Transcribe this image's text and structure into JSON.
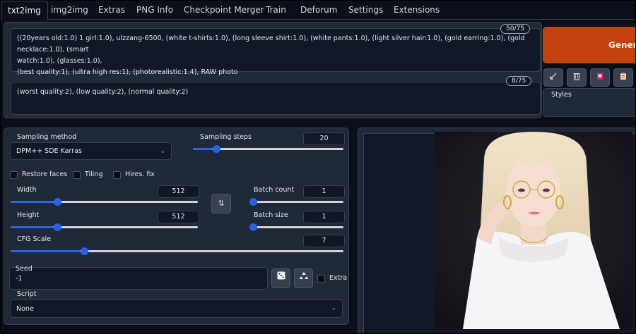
{
  "tabs": [
    "txt2img",
    "img2img",
    "Extras",
    "PNG Info",
    "Checkpoint Merger",
    "Train",
    "Deforum",
    "Settings",
    "Extensions"
  ],
  "prompt": {
    "line1": "((20years old:1.0) 1 girl:1.0), ulzzang-6500, (white t-shirts:1.0), (long sleeve shirt:1.0), (white pants:1.0), (light silver hair:1.0), (gold earring:1.0), (gold necklace:1.0), (smart",
    "line2": "watch:1.0), (glasses:1.0),",
    "line3": "(best quality:1), (ultra high res:1), (photorealistic:1.4), RAW photo",
    "token_count": "50/75"
  },
  "negative_prompt": {
    "text": "(worst quality:2), (low quality:2), (normal quality:2)",
    "token_count": "8/75"
  },
  "generate_label": "Generate",
  "styles_label": "Styles",
  "tool_icons": [
    "arrow-icon",
    "trash-icon",
    "card-icon",
    "clipboard-icon"
  ],
  "sampling_method": {
    "label": "Sampling method",
    "value": "DPM++ SDE Karras"
  },
  "sampling_steps": {
    "label": "Sampling steps",
    "value": "20",
    "fraction": 0.13
  },
  "checkboxes": {
    "restore_faces": "Restore faces",
    "tiling": "Tiling",
    "hires_fix": "Hires. fix"
  },
  "width": {
    "label": "Width",
    "value": "512",
    "fraction": 0.23
  },
  "height": {
    "label": "Height",
    "value": "512",
    "fraction": 0.23
  },
  "batch_count": {
    "label": "Batch count",
    "value": "1",
    "fraction": 0.0
  },
  "batch_size": {
    "label": "Batch size",
    "value": "1",
    "fraction": 0.0
  },
  "cfg_scale": {
    "label": "CFG Scale",
    "value": "7",
    "fraction": 0.21
  },
  "seed": {
    "label": "Seed",
    "value": "-1",
    "extra_label": "Extra"
  },
  "script": {
    "label": "Script",
    "value": "None"
  },
  "colors": {
    "accent": "#2563eb",
    "generate": "#c2410c",
    "panel": "#1f2937",
    "background": "#0b0f19"
  }
}
